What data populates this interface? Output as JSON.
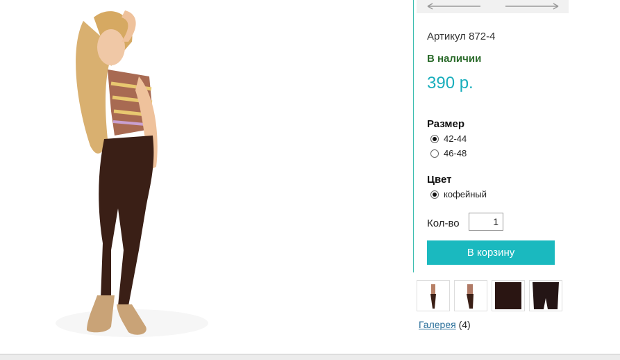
{
  "product": {
    "sku": "Артикул 872-4",
    "availability": "В наличии",
    "price": "390 р."
  },
  "size": {
    "title": "Размер",
    "options": [
      "42-44",
      "46-48"
    ],
    "selected": "42-44"
  },
  "color": {
    "title": "Цвет",
    "options": [
      "кофейный"
    ],
    "selected": "кофейный"
  },
  "quantity": {
    "label": "Кол-во",
    "value": "1"
  },
  "cart": {
    "button_label": "В корзину"
  },
  "gallery": {
    "link_label": "Галерея",
    "count": "(4)"
  },
  "colors": {
    "accent": "#1ab9bf",
    "price": "#19aebc",
    "in_stock": "#2b6b2b",
    "legging": "#3a1f16",
    "link": "#2a6f9a"
  },
  "icons": [
    "arrow-left-icon",
    "arrow-right-icon",
    "radio-icon"
  ]
}
